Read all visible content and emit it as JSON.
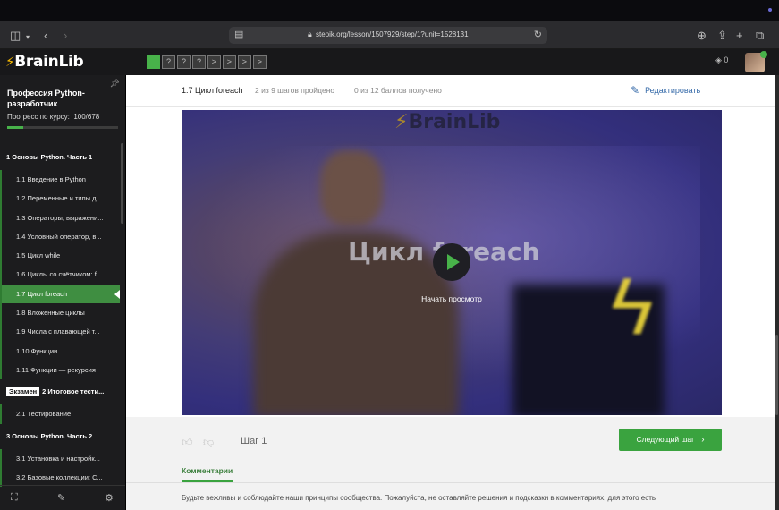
{
  "browser": {
    "url": "stepik.org/lesson/1507929/step/1?unit=1528131",
    "icons": [
      "sidebar-toggle-icon",
      "chevron-down-icon",
      "back-icon",
      "forward-icon",
      "page-icon",
      "lock-icon",
      "reload-icon",
      "download-icon",
      "share-icon",
      "new-tab-icon",
      "tabs-overview-icon"
    ]
  },
  "appbar": {
    "logo": "BrainLib",
    "steps": [
      "▶",
      "",
      "?",
      "?",
      "?",
      "≥",
      "≥",
      "≥",
      "≥"
    ],
    "points": "0"
  },
  "sidebar": {
    "course_title": "Профессия Python-разработчик",
    "progress_label": "Прогресс по курсу:",
    "progress_value": "100/678",
    "progress_fraction": 0.148,
    "items": [
      {
        "type": "section",
        "label": "1  Основы Python. Часть 1"
      },
      {
        "type": "lesson",
        "label": "1.1  Введение в Python"
      },
      {
        "type": "lesson",
        "label": "1.2  Переменные и типы д..."
      },
      {
        "type": "lesson",
        "label": "1.3  Операторы, выражени..."
      },
      {
        "type": "lesson",
        "label": "1.4  Условный оператор, в..."
      },
      {
        "type": "lesson",
        "label": "1.5  Цикл while"
      },
      {
        "type": "lesson",
        "label": "1.6  Циклы со счётчиком: f..."
      },
      {
        "type": "lesson",
        "label": "1.7  Цикл foreach",
        "active": true
      },
      {
        "type": "lesson",
        "label": "1.8  Вложенные циклы"
      },
      {
        "type": "lesson",
        "label": "1.9  Числа с плавающей т..."
      },
      {
        "type": "lesson",
        "label": "1.10  Функции"
      },
      {
        "type": "lesson",
        "label": "1.11  Функции — рекурсия"
      },
      {
        "type": "section",
        "label": "2  Итоговое тести...",
        "tag": "Экзамен"
      },
      {
        "type": "lesson",
        "label": "2.1  Тестирование"
      },
      {
        "type": "section",
        "label": "3  Основы Python. Часть 2"
      },
      {
        "type": "lesson",
        "label": "3.1  Установка и настройк..."
      },
      {
        "type": "lesson",
        "label": "3.2  Базовые коллекции: С..."
      }
    ]
  },
  "step": {
    "title": "1.7 Цикл foreach",
    "progress": "2 из 9 шагов пройдено",
    "score": "0 из 12 баллов  получено",
    "edit_label": "Редактировать"
  },
  "video": {
    "logo": "BrainLib",
    "title": "Цикл foreach",
    "start_label": "Начать просмотр"
  },
  "footer": {
    "step_label": "Шаг 1",
    "next_label": "Следующий шаг",
    "comments_tab": "Комментарии",
    "comments_note": "Будьте вежливы и соблюдайте наши принципы сообщества. Пожалуйста, не оставляйте решения и подсказки в комментариях, для этого есть"
  },
  "colors": {
    "accent_green": "#48b24a",
    "link_blue": "#3469a8",
    "logo_yellow": "#f5b800"
  }
}
